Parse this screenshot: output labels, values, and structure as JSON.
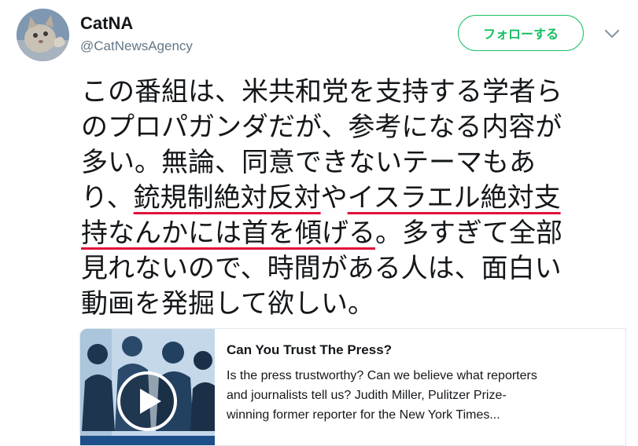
{
  "author": {
    "display_name": "CatNA",
    "handle": "@CatNewsAgency"
  },
  "follow_button_label": "フォローする",
  "tweet": {
    "line1": "この番組は、米共和党を支持する学者ら",
    "line2": "のプロパガンダだが、参考になる内容が",
    "line3": "多い。無論、同意できないテーマもあ",
    "line4_pre": "り、",
    "line4_ul1": "銃規制絶対反対",
    "line4_mid": "や",
    "line4_ul2": "イスラエル絶対支",
    "line5_ul": "持なんかには首を傾げる",
    "line5_post": "。多すぎて全部",
    "line6": "見れないので、時間がある人は、面白い",
    "line7": "動画を発掘して欲しい。"
  },
  "card": {
    "title": "Can You Trust The Press?",
    "desc_line1": "Is the press trustworthy? Can we believe what reporters",
    "desc_line2": "and journalists tell us? Judith Miller, Pulitzer Prize-",
    "desc_line3": "winning former reporter for the New York Times...",
    "icon": "play-icon"
  },
  "colors": {
    "follow_green": "#17bf63",
    "underline_red": "#e0123b",
    "text": "#14171a",
    "muted": "#657786"
  }
}
